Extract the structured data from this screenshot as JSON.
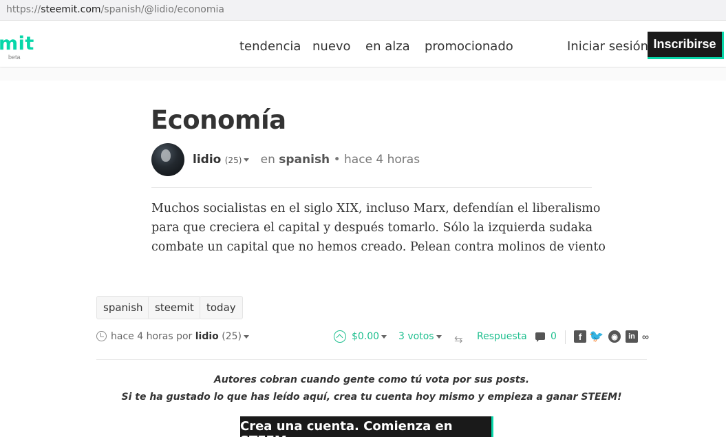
{
  "browser": {
    "url_scheme": "https://",
    "url_host": "steemit.com",
    "url_path": "/spanish/@lidio/economia"
  },
  "header": {
    "logo": "mit",
    "beta": "beta",
    "nav": [
      "tendencia",
      "nuevo",
      "en alza",
      "promocionado"
    ],
    "login": "Iniciar sesión",
    "signup": "Inscribirse"
  },
  "post": {
    "title": "Economía",
    "author": "lidio",
    "reputation": "(25)",
    "in_label": "en",
    "category": "spanish",
    "time": "hace 4 horas",
    "body": "Muchos socialistas en el siglo XIX, incluso Marx, defendían el liberalismo para que creciera el capital y después tomarlo. Sólo la izquierda sudaka combate un capital que no hemos creado. Pelean contra molinos de viento",
    "tags": [
      "spanish",
      "steemit",
      "today"
    ]
  },
  "footer": {
    "time_by": "hace 4 horas por",
    "author": "lidio",
    "reputation": "(25)",
    "payout": "$0.00",
    "votes": "3 votos",
    "reply": "Respuesta",
    "comments": "0",
    "share_icons": [
      "facebook-icon",
      "twitter-icon",
      "reddit-icon",
      "linkedin-icon",
      "link-icon"
    ]
  },
  "promo": {
    "line1": "Autores cobran cuando gente como tú vota por sus posts.",
    "line2": "Si te ha gustado lo que has leído aquí, crea tu cuenta hoy mismo y empieza a ganar STEEM!",
    "cta": "Crea una cuenta. Comienza en STEEM"
  },
  "colors": {
    "accent": "#07d7a9",
    "dark": "#1a1a1a",
    "link_green": "#1fbf8f"
  }
}
